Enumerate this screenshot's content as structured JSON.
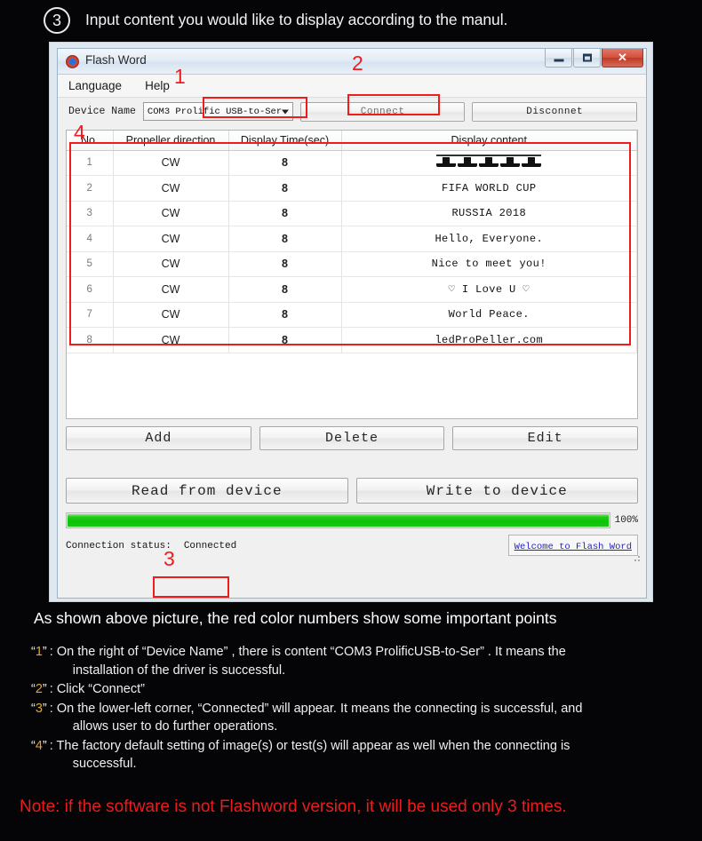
{
  "step": {
    "number": "3",
    "text": "Input content you would like to display according to the manul."
  },
  "app_window": {
    "title": "Flash Word",
    "icon": "flashword-target-icon",
    "window_buttons": {
      "minimize": "–",
      "maximize": "□",
      "close": "✕"
    },
    "menu": [
      "Language",
      "Help"
    ],
    "device_row": {
      "label": "Device Name",
      "selected_device": "COM3 Prolific USB-to-Ser",
      "connect_label": "Connect",
      "disconnect_label": "Disconnet"
    },
    "table": {
      "columns": [
        "No.",
        "Propeller direction",
        "Display Time(sec)",
        "Display content"
      ],
      "rows": [
        {
          "no": "1",
          "dir": "CW",
          "time": "8",
          "content": "",
          "content_is_graphic": true
        },
        {
          "no": "2",
          "dir": "CW",
          "time": "8",
          "content": "FIFA WORLD CUP"
        },
        {
          "no": "3",
          "dir": "CW",
          "time": "8",
          "content": "RUSSIA 2018"
        },
        {
          "no": "4",
          "dir": "CW",
          "time": "8",
          "content": "Hello, Everyone."
        },
        {
          "no": "5",
          "dir": "CW",
          "time": "8",
          "content": "Nice to meet you!"
        },
        {
          "no": "6",
          "dir": "CW",
          "time": "8",
          "content": "♡ I Love U ♡"
        },
        {
          "no": "7",
          "dir": "CW",
          "time": "8",
          "content": "World Peace."
        },
        {
          "no": "8",
          "dir": "CW",
          "time": "8",
          "content": "ledProPeller.com"
        }
      ]
    },
    "actions": {
      "add": "Add",
      "delete": "Delete",
      "edit": "Edit",
      "read": "Read from device",
      "write": "Write to device"
    },
    "progress": {
      "percent_label": "100%",
      "value": 100
    },
    "status": {
      "label": "Connection status:",
      "value": "Connected",
      "link": "Welcome to Flash Word"
    },
    "annotations": [
      {
        "id": "1",
        "target": "device-name-combo"
      },
      {
        "id": "2",
        "target": "connect-button"
      },
      {
        "id": "3",
        "target": "connection-status-value"
      },
      {
        "id": "4",
        "target": "content-table"
      }
    ]
  },
  "caption": {
    "title": "As shown above picture, the red color numbers show some important points",
    "notes": [
      {
        "key": "“1”",
        "line1": ": On the right of  “Device Name” , there is content  “COM3 ProlificUSB-to-Ser” . It means the",
        "line2": "installation of the driver is successful."
      },
      {
        "key": "“2”",
        "line1": ": Click  “Connect”",
        "line2": ""
      },
      {
        "key": "“3”",
        "line1": ": On the lower-left corner,  “Connected”  will appear. It means the connecting is successful, and",
        "line2": "allows user to do further operations."
      },
      {
        "key": "“4”",
        "line1": ": The factory default setting of image(s) or test(s) will appear as well when the connecting is",
        "line2": "successful."
      }
    ],
    "footnote": "Note: if the software is not Flashword version, it will be used only 3 times."
  },
  "colors": {
    "background": "#050507",
    "annotation_red": "#f21b1b",
    "footnote_red": "#ec1c1c",
    "key_gold": "#e2a53a",
    "progress_green": "#12c40c",
    "link_blue": "#2222cc"
  }
}
